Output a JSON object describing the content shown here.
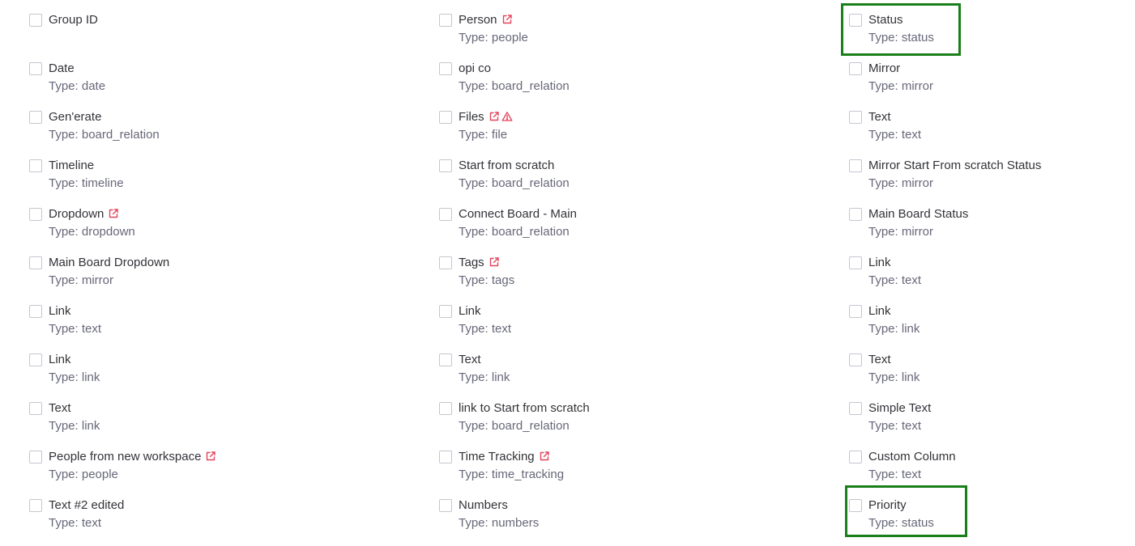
{
  "type_prefix": "Type: ",
  "colors": {
    "external": "#e2445c",
    "highlight": "#1a7f1a",
    "checkbox_border": "#c5c7d0"
  },
  "columns": [
    {
      "items": [
        {
          "name": "Group ID",
          "type": "",
          "icons": []
        },
        {
          "name": "Date",
          "type": "date",
          "icons": []
        },
        {
          "name": "Gen'erate",
          "type": "board_relation",
          "icons": []
        },
        {
          "name": "Timeline",
          "type": "timeline",
          "icons": []
        },
        {
          "name": "Dropdown",
          "type": "dropdown",
          "icons": [
            "external-link-icon"
          ]
        },
        {
          "name": "Main Board Dropdown",
          "type": "mirror",
          "icons": []
        },
        {
          "name": "Link",
          "type": "text",
          "icons": []
        },
        {
          "name": "Link",
          "type": "link",
          "icons": []
        },
        {
          "name": "Text",
          "type": "link",
          "icons": []
        },
        {
          "name": "People from new workspace",
          "type": "people",
          "icons": [
            "external-link-icon"
          ]
        },
        {
          "name": "Text #2 edited",
          "type": "text",
          "icons": []
        }
      ]
    },
    {
      "items": [
        {
          "name": "Person",
          "type": "people",
          "icons": [
            "external-link-icon"
          ]
        },
        {
          "name": "opi co",
          "type": "board_relation",
          "icons": []
        },
        {
          "name": "Files",
          "type": "file",
          "icons": [
            "external-link-icon",
            "warning-icon"
          ]
        },
        {
          "name": "Start from scratch",
          "type": "board_relation",
          "icons": []
        },
        {
          "name": "Connect Board - Main",
          "type": "board_relation",
          "icons": []
        },
        {
          "name": "Tags",
          "type": "tags",
          "icons": [
            "external-link-icon"
          ]
        },
        {
          "name": "Link",
          "type": "text",
          "icons": []
        },
        {
          "name": "Text",
          "type": "link",
          "icons": []
        },
        {
          "name": "link to Start from scratch",
          "type": "board_relation",
          "icons": []
        },
        {
          "name": "Time Tracking",
          "type": "time_tracking",
          "icons": [
            "external-link-icon"
          ]
        },
        {
          "name": "Numbers",
          "type": "numbers",
          "icons": []
        }
      ]
    },
    {
      "items": [
        {
          "name": "Status",
          "type": "status",
          "icons": [],
          "highlighted": true
        },
        {
          "name": "Mirror",
          "type": "mirror",
          "icons": []
        },
        {
          "name": "Text",
          "type": "text",
          "icons": []
        },
        {
          "name": "Mirror Start From scratch Status",
          "type": "mirror",
          "icons": []
        },
        {
          "name": "Main Board Status",
          "type": "mirror",
          "icons": []
        },
        {
          "name": "Link",
          "type": "text",
          "icons": []
        },
        {
          "name": "Link",
          "type": "link",
          "icons": []
        },
        {
          "name": "Text",
          "type": "link",
          "icons": []
        },
        {
          "name": "Simple Text",
          "type": "text",
          "icons": []
        },
        {
          "name": "Custom Column",
          "type": "text",
          "icons": []
        },
        {
          "name": "Priority",
          "type": "status",
          "icons": [],
          "highlighted": true
        }
      ]
    }
  ]
}
